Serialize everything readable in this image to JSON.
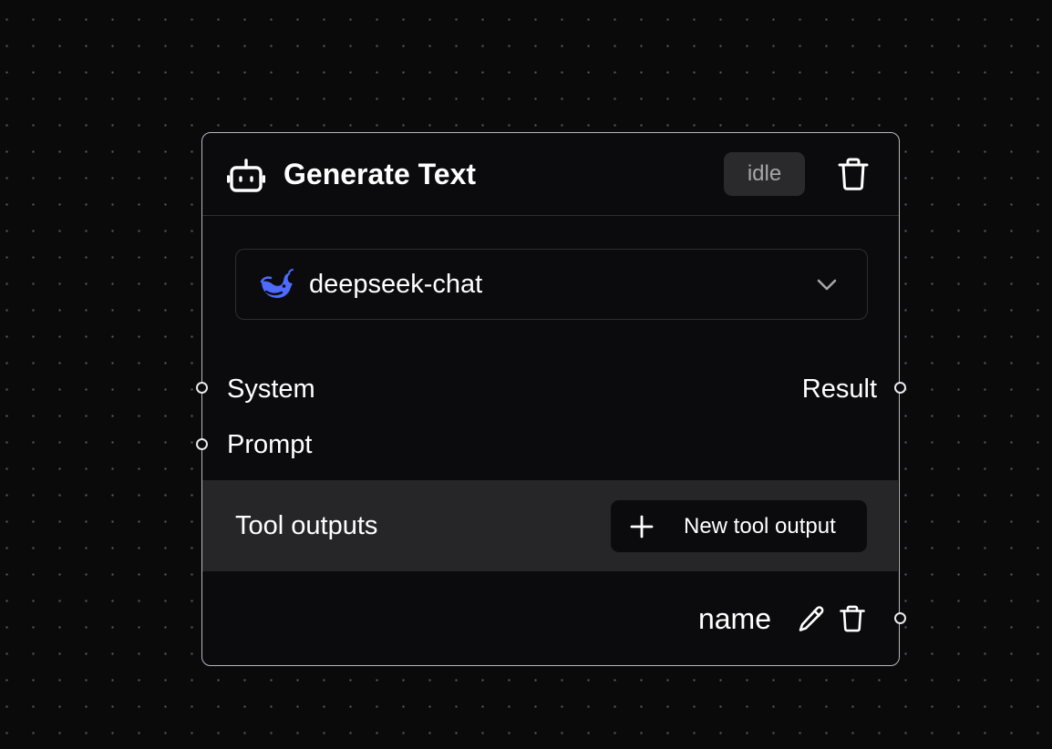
{
  "node": {
    "title": "Generate Text",
    "icon": "bot-icon",
    "status": "idle",
    "delete_icon": "trash-icon"
  },
  "model_select": {
    "value": "deepseek-chat",
    "logo_icon": "deepseek-whale-icon",
    "logo_color": "#4d6bfe",
    "chevron_icon": "chevron-down-icon"
  },
  "inputs": [
    {
      "label": "System"
    },
    {
      "label": "Prompt"
    }
  ],
  "outputs": [
    {
      "label": "Result"
    }
  ],
  "tool_outputs": {
    "label": "Tool outputs",
    "new_button_label": "New tool output",
    "items": [
      {
        "name": "name",
        "edit_icon": "pencil-icon",
        "delete_icon": "trash-icon"
      }
    ]
  },
  "colors": {
    "background": "#0a0a0b",
    "node_border": "#b9b9bc",
    "tools_bar": "#262629",
    "badge": "#2a2a2d"
  }
}
